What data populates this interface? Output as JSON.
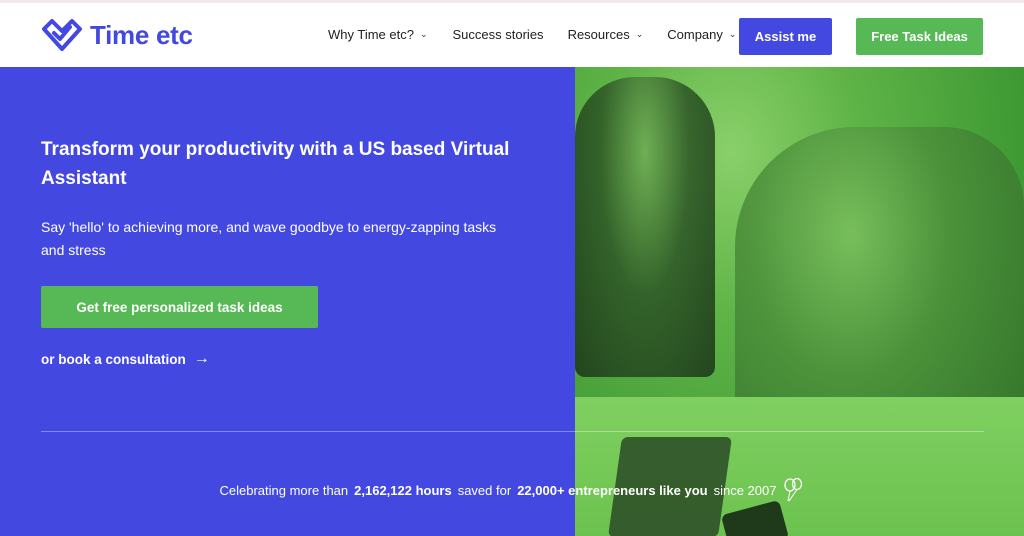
{
  "header": {
    "logo_text": "Time etc",
    "nav": [
      {
        "label": "Why Time etc?",
        "has_dropdown": true
      },
      {
        "label": "Success stories",
        "has_dropdown": false
      },
      {
        "label": "Resources",
        "has_dropdown": true
      },
      {
        "label": "Company",
        "has_dropdown": true
      }
    ],
    "assist_button": "Assist me",
    "ideas_button": "Free Task Ideas"
  },
  "hero": {
    "title": "Transform your productivity with a US based Virtual Assistant",
    "subtitle": "Say 'hello' to achieving more, and wave goodbye to energy-zapping tasks and stress",
    "cta_button": "Get free personalized task ideas",
    "consult_link": "or book a consultation",
    "consult_arrow": "→"
  },
  "stats": {
    "prefix": "Celebrating more than",
    "hours": "2,162,122 hours",
    "middle": "saved for",
    "entrepreneurs": "22,000+ entrepreneurs like you",
    "suffix": "since 2007"
  },
  "colors": {
    "brand_blue": "#4349e0",
    "brand_green": "#56b955"
  },
  "icons": {
    "logo": "heart-check-logo-icon",
    "chevron": "chevron-down-icon",
    "arrow": "arrow-right-icon",
    "balloon": "balloon-icon"
  }
}
